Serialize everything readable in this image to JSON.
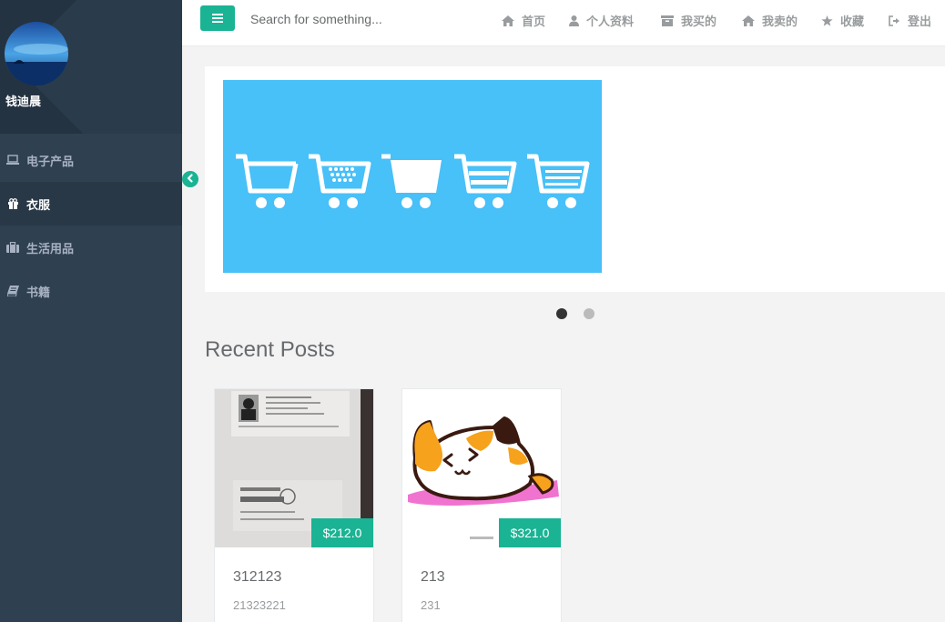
{
  "user": {
    "name": "钱迪晨"
  },
  "sidebar": {
    "items": [
      {
        "label": "电子产品",
        "icon": "laptop-icon",
        "active": false
      },
      {
        "label": "衣服",
        "icon": "gift-icon",
        "active": true
      },
      {
        "label": "生活用品",
        "icon": "briefcase-icon",
        "active": false
      },
      {
        "label": "书籍",
        "icon": "book-icon",
        "active": false
      }
    ]
  },
  "search": {
    "placeholder": "Search for something..."
  },
  "topnav": {
    "items": [
      {
        "label": "首页",
        "icon": "home-icon"
      },
      {
        "label": "个人资料",
        "icon": "user-icon"
      },
      {
        "label": "我买的",
        "icon": "archive-icon"
      },
      {
        "label": "我卖的",
        "icon": "home-icon"
      },
      {
        "label": "收藏",
        "icon": "star-icon"
      },
      {
        "label": "登出",
        "icon": "sign-out-icon"
      }
    ]
  },
  "carousel": {
    "slide_count": 2,
    "active_index": 0
  },
  "recent_posts": {
    "title": "Recent Posts",
    "posts": [
      {
        "title": "312123",
        "description": "21323221",
        "price": "$212.0"
      },
      {
        "title": "213",
        "description": "231",
        "price": "$321.0"
      }
    ]
  },
  "colors": {
    "accent": "#1ab394",
    "sidebar_bg": "#2f4050",
    "sidebar_active": "#293846",
    "banner_bg": "#48c0f8"
  }
}
